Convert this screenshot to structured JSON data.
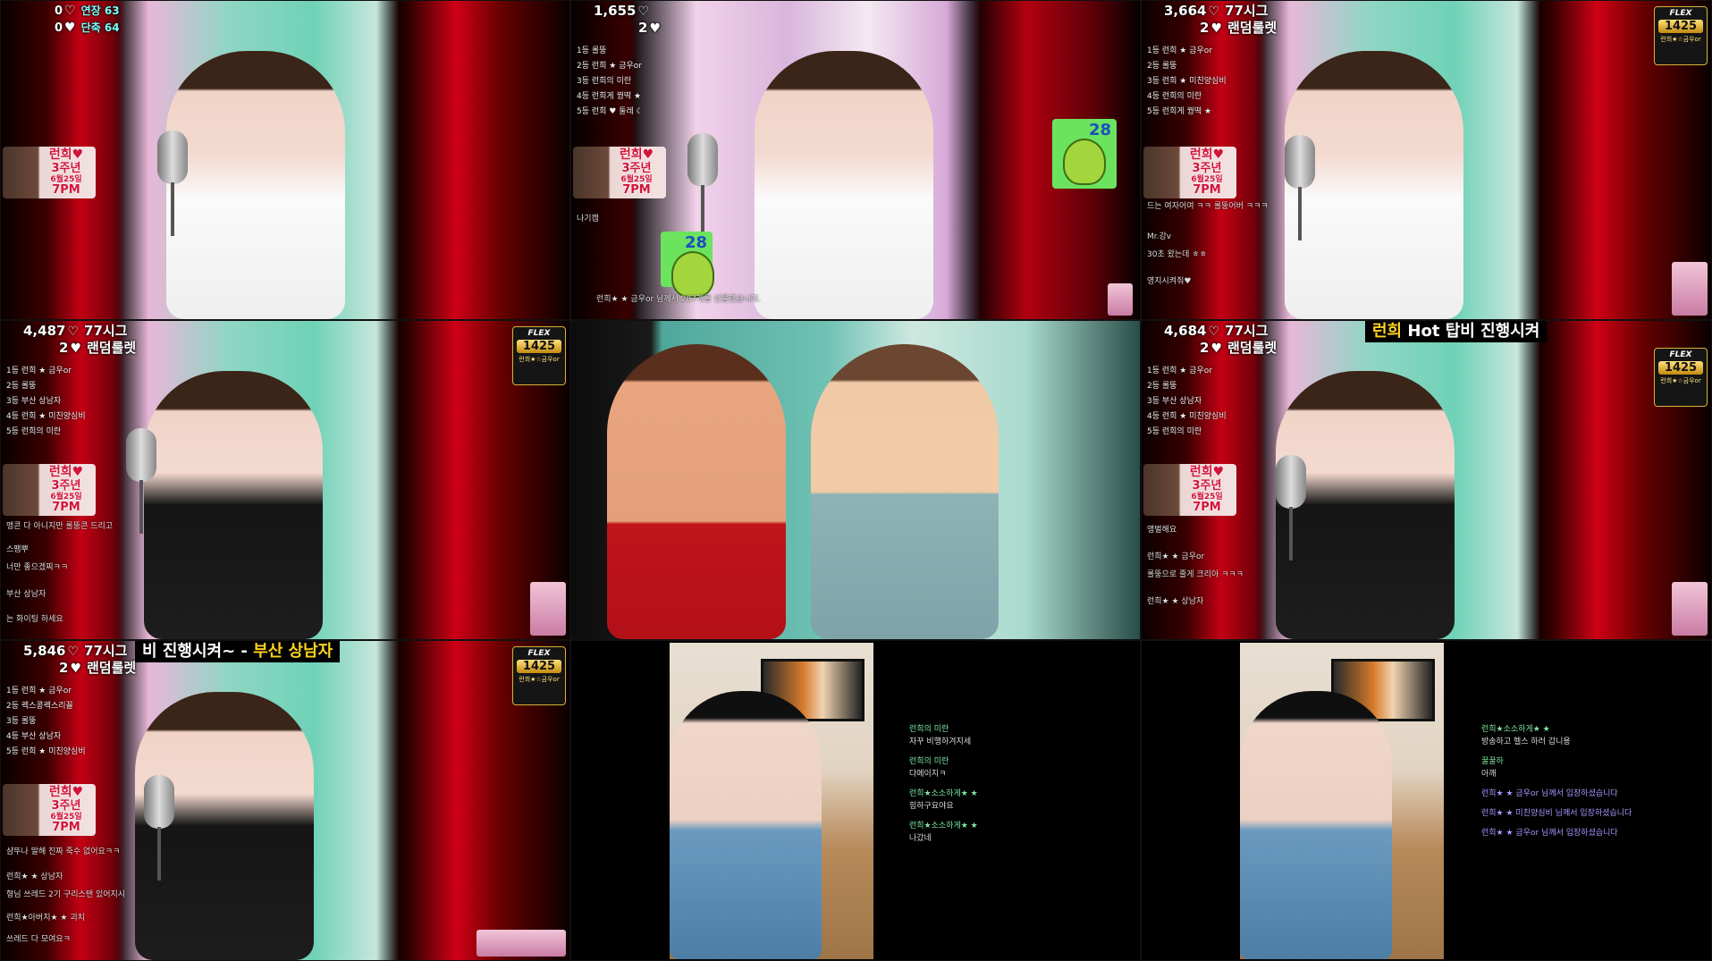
{
  "tiles": {
    "t1": {
      "count1": "0",
      "label1": "연장 63",
      "count2": "0",
      "label2": "단축 64"
    },
    "t2": {
      "count1": "1,655",
      "count2": "2",
      "rank": [
        "1등 롤뚱",
        "2등 런희 ★ 금우or",
        "3등 런희의 미란",
        "4등 런희게 꿩떡 ★",
        "5등 런희 ♥ 둘레 ☾"
      ],
      "chat1": "나기캠",
      "chat2": "런희★ ★ 금우or 님께서 287개를 선물했습니다.",
      "sticker_num": "28"
    },
    "t3": {
      "count1": "3,664",
      "label1": "77시그",
      "count2": "2",
      "label2": "랜덤룰렛",
      "rank": [
        "1등 런희 ★ 금우or",
        "2등 롤뚱",
        "3등 런희 ★ 미친양심비",
        "4등 런희의 미란",
        "5등 런희게 꿩떡 ★"
      ],
      "chat": [
        "드는 여자어여 ㅋㅋ 롤뚱어버 ㅋㅋㅋ",
        "Mr.강v",
        "30초 왔는데 ㅎㅎ",
        "영지시켜줘♥"
      ]
    },
    "t4": {
      "count1": "4,487",
      "label1": "77시그",
      "count2": "2",
      "label2": "랜덤룰렛",
      "rank": [
        "1등 런희 ★ 금우or",
        "2등 롤뚱",
        "3등 부산 상남자",
        "4등 런희 ★ 미친양심비",
        "5등 런희의 미란"
      ],
      "chat": [
        "맹콘 다 아니지만 롤뚱콘 드리고",
        "스팸뿌",
        "너만 좋으겠찌ㅋㅋ",
        "부산 상남자",
        "는 화이팅 하세요"
      ]
    },
    "t5": {
      "label": "cartoon"
    },
    "t6": {
      "count1": "4,684",
      "label1": "77시그",
      "count2": "2",
      "label2": "랜덤룰렛",
      "banner_a": "런희",
      "banner_b": "Hot",
      "banner_c": "탑비 진행시켜",
      "rank": [
        "1등 런희 ★ 금우or",
        "2등 롤뚱",
        "3등 부산 상남자",
        "4등 런희 ★ 미친양심비",
        "5등 런희의 미란"
      ],
      "chat": [
        "앵벌해요",
        "런희★ ★ 금우or",
        "롤뚱으로 줄게 크리아 ㅋㅋㅋ",
        "런희★ ★ 상남자"
      ]
    },
    "t7": {
      "count1": "5,846",
      "label1": "77시그",
      "count2": "2",
      "label2": "랜덤룰렛",
      "banner_a": "비 진행시켜~ -",
      "banner_b": "부산 상남자",
      "rank": [
        "1등 런희 ★ 금우or",
        "2등 렉스콩렉스리꼴",
        "3등 롤뚱",
        "4등 부산 상남자",
        "5등 런희 ★ 미친양심비"
      ],
      "chat": [
        "샴뚜나 말해 진짜 죽수 없어요ㅋㅋ",
        "런희★ ★ 상남자",
        "형님 쓰레드 2기 구리스탠 있어지시",
        "런희★아버지★ ★ 괴치",
        "쓰레드 다 모여요ㅋ"
      ]
    },
    "t8": {
      "chat": [
        "런희의 미란",
        "자꾸 비행하겨지세",
        "런희의 미란",
        "다에이지ㅋ",
        "런희★소소하게★ ★",
        "힘하구요야요",
        "런희★소소하게★ ★",
        "나갔네"
      ]
    },
    "t9": {
      "chat": [
        "런희★소소하게★ ★",
        "방송하고 헬스 하러 갑니용",
        "꿀꿀하",
        "아깨",
        "런희★ ★ 금우or 님께서 입장하셨습니다",
        "런희★ ★ 미친양심비 님께서 입장하셨습니다",
        "런희★ ★ 금우or 님께서 입장하셨습니다"
      ]
    }
  },
  "poster": {
    "line1": "런희♥",
    "line2": "3주년",
    "line3": "6월25일",
    "line4": "7PM"
  },
  "flex": {
    "brand": "FLEX",
    "sub": "런희★☆금우or",
    "num": "1425"
  },
  "colors": {
    "gold": "#ffd21f",
    "red": "#c40014",
    "mint": "#6fd2b7"
  }
}
